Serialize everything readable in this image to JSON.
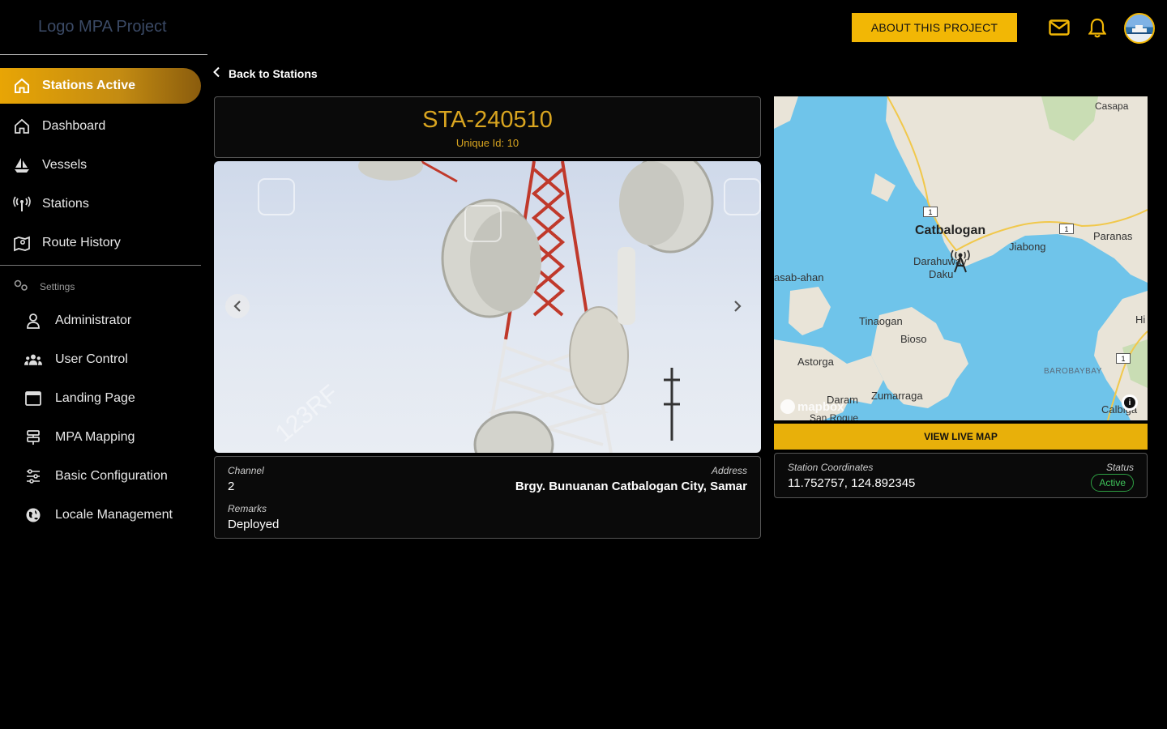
{
  "header": {
    "logo_text": "Logo MPA Project",
    "about_button": "ABOUT THIS PROJECT",
    "accent_color": "#f2b705"
  },
  "sidebar": {
    "active_item": {
      "label": "Stations Active",
      "icon": "home-icon"
    },
    "items": [
      {
        "label": "Dashboard",
        "icon": "home-outline-icon"
      },
      {
        "label": "Vessels",
        "icon": "sailboat-icon"
      },
      {
        "label": "Stations",
        "icon": "antenna-icon"
      },
      {
        "label": "Route History",
        "icon": "map-pin-icon"
      }
    ],
    "settings_heading": "Settings",
    "settings_items": [
      {
        "label": "Administrator",
        "icon": "user-icon"
      },
      {
        "label": "User Control",
        "icon": "users-icon"
      },
      {
        "label": "Landing Page",
        "icon": "browser-window-icon"
      },
      {
        "label": "MPA Mapping",
        "icon": "signpost-icon"
      },
      {
        "label": "Basic Configuration",
        "icon": "sliders-icon"
      },
      {
        "label": "Locale Management",
        "icon": "globe-icon"
      }
    ]
  },
  "page": {
    "back_label": "Back to Stations",
    "station_code": "STA-240510",
    "unique_id": "Unique Id: 10",
    "image_watermark": "123RF"
  },
  "details": {
    "channel_caption": "Channel",
    "channel_value": "2",
    "address_caption": "Address",
    "address_value": "Brgy. Bunuanan Catbalogan City, Samar",
    "remarks_caption": "Remarks",
    "remarks_value": "Deployed"
  },
  "map": {
    "labels": [
      "Casapa",
      "Catbalogan",
      "Jiabong",
      "Paranas",
      "Darahuway",
      "Daku",
      "asab-ahan",
      "Tinaogan",
      "Bioso",
      "Astorga",
      "Daram",
      "Zumarraga",
      "San Roque",
      "BAROBAYBAY",
      "Calbiga",
      "Hi"
    ],
    "road_markers": [
      "1",
      "1",
      "1"
    ],
    "attribution": "mapbox",
    "view_button": "VIEW LIVE MAP"
  },
  "station": {
    "coords_caption": "Station Coordinates",
    "coords_value": "11.752757, 124.892345",
    "status_caption": "Status",
    "status_value": "Active",
    "status_color": "#3fc35a"
  }
}
